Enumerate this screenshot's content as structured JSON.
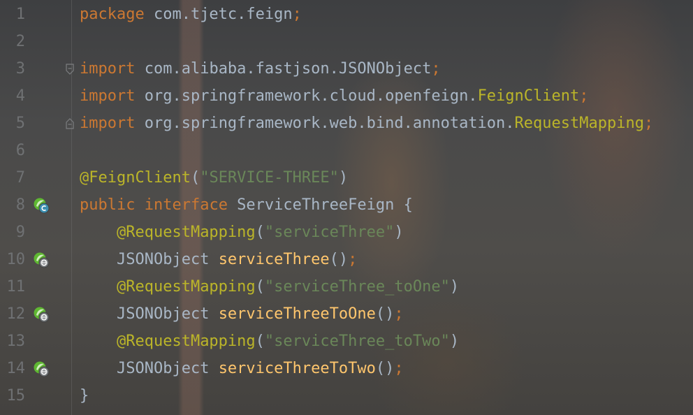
{
  "editor": {
    "lines": [
      {
        "num": "1",
        "tokens": {
          "kw": "package",
          "pkg": " com.tjetc.feign",
          "semi": ";"
        }
      },
      {
        "num": "2"
      },
      {
        "num": "3",
        "tokens": {
          "kw": "import",
          "path": " com.alibaba.fastjson.",
          "cls": "JSONObject",
          "semi": ";"
        }
      },
      {
        "num": "4",
        "tokens": {
          "kw": "import",
          "path": " org.springframework.cloud.openfeign.",
          "cls": "FeignClient",
          "semi": ";"
        }
      },
      {
        "num": "5",
        "tokens": {
          "kw": "import",
          "path": " org.springframework.web.bind.annotation.",
          "cls": "RequestMapping",
          "semi": ";"
        }
      },
      {
        "num": "6"
      },
      {
        "num": "7",
        "tokens": {
          "ann": "@FeignClient",
          "open": "(",
          "str": "\"SERVICE-THREE\"",
          "close": ")"
        }
      },
      {
        "num": "8",
        "tokens": {
          "kw1": "public",
          "kw2": " interface",
          "name": " ServiceThreeFeign {"
        }
      },
      {
        "num": "9",
        "tokens": {
          "ann": "@RequestMapping",
          "open": "(",
          "str": "\"serviceThree\"",
          "close": ")"
        }
      },
      {
        "num": "10",
        "tokens": {
          "type": "JSONObject ",
          "meth": "serviceThree",
          "parens": "()",
          "semi": ";"
        }
      },
      {
        "num": "11",
        "tokens": {
          "ann": "@RequestMapping",
          "open": "(",
          "str": "\"serviceThree_toOne\"",
          "close": ")"
        }
      },
      {
        "num": "12",
        "tokens": {
          "type": "JSONObject ",
          "meth": "serviceThreeToOne",
          "parens": "()",
          "semi": ";"
        }
      },
      {
        "num": "13",
        "tokens": {
          "ann": "@RequestMapping",
          "open": "(",
          "str": "\"serviceThree_toTwo\"",
          "close": ")"
        }
      },
      {
        "num": "14",
        "tokens": {
          "type": "JSONObject ",
          "meth": "serviceThreeToTwo",
          "parens": "()",
          "semi": ";"
        }
      },
      {
        "num": "15",
        "tokens": {
          "brace": "}"
        }
      }
    ]
  },
  "gutter_icons": {
    "line8": "spring-interface-icon",
    "line10": "spring-endpoint-icon",
    "line12": "spring-endpoint-icon",
    "line14": "spring-endpoint-icon"
  },
  "colors": {
    "keyword": "#cc7832",
    "annotation": "#bbb529",
    "string": "#6a8759",
    "method": "#ffc66d",
    "plain": "#a9b7c6",
    "line_number": "#6f7173",
    "spring_green": "#5fb832"
  }
}
